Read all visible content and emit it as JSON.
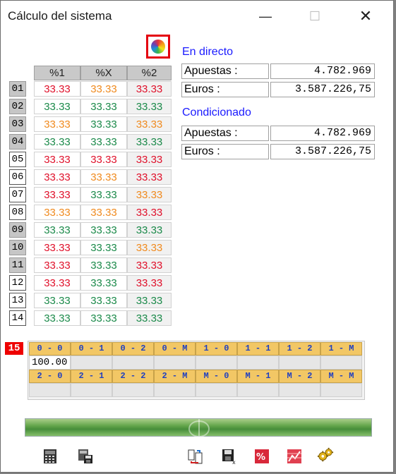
{
  "window": {
    "title": "Cálculo del sistema",
    "min": "—",
    "max": "☐",
    "close": "✕"
  },
  "columns": [
    "%1",
    "%X",
    "%2"
  ],
  "rows": [
    {
      "label": "01",
      "style": "g",
      "cells": [
        [
          "33.33",
          "red"
        ],
        [
          "33.33",
          "org"
        ],
        [
          "33.33",
          "red"
        ]
      ]
    },
    {
      "label": "02",
      "style": "g",
      "cells": [
        [
          "33.33",
          "grn"
        ],
        [
          "33.33",
          "grn"
        ],
        [
          "33.33",
          "grn"
        ]
      ]
    },
    {
      "label": "03",
      "style": "g",
      "cells": [
        [
          "33.33",
          "org"
        ],
        [
          "33.33",
          "grn"
        ],
        [
          "33.33",
          "org"
        ]
      ]
    },
    {
      "label": "04",
      "style": "g",
      "cells": [
        [
          "33.33",
          "grn"
        ],
        [
          "33.33",
          "grn"
        ],
        [
          "33.33",
          "grn"
        ]
      ]
    },
    {
      "label": "05",
      "style": "w",
      "cells": [
        [
          "33.33",
          "red"
        ],
        [
          "33.33",
          "red"
        ],
        [
          "33.33",
          "red"
        ]
      ]
    },
    {
      "label": "06",
      "style": "w",
      "cells": [
        [
          "33.33",
          "red"
        ],
        [
          "33.33",
          "org"
        ],
        [
          "33.33",
          "red"
        ]
      ]
    },
    {
      "label": "07",
      "style": "w",
      "cells": [
        [
          "33.33",
          "red"
        ],
        [
          "33.33",
          "grn"
        ],
        [
          "33.33",
          "org"
        ]
      ]
    },
    {
      "label": "08",
      "style": "w",
      "cells": [
        [
          "33.33",
          "org"
        ],
        [
          "33.33",
          "org"
        ],
        [
          "33.33",
          "red"
        ]
      ]
    },
    {
      "label": "09",
      "style": "g",
      "cells": [
        [
          "33.33",
          "grn"
        ],
        [
          "33.33",
          "grn"
        ],
        [
          "33.33",
          "grn"
        ]
      ]
    },
    {
      "label": "10",
      "style": "g",
      "cells": [
        [
          "33.33",
          "red"
        ],
        [
          "33.33",
          "grn"
        ],
        [
          "33.33",
          "org"
        ]
      ]
    },
    {
      "label": "11",
      "style": "g",
      "cells": [
        [
          "33.33",
          "red"
        ],
        [
          "33.33",
          "grn"
        ],
        [
          "33.33",
          "red"
        ]
      ]
    },
    {
      "label": "12",
      "style": "w",
      "cells": [
        [
          "33.33",
          "red"
        ],
        [
          "33.33",
          "grn"
        ],
        [
          "33.33",
          "red"
        ]
      ]
    },
    {
      "label": "13",
      "style": "w",
      "cells": [
        [
          "33.33",
          "grn"
        ],
        [
          "33.33",
          "grn"
        ],
        [
          "33.33",
          "grn"
        ]
      ]
    },
    {
      "label": "14",
      "style": "w",
      "cells": [
        [
          "33.33",
          "grn"
        ],
        [
          "33.33",
          "grn"
        ],
        [
          "33.33",
          "grn"
        ]
      ]
    }
  ],
  "en_directo": {
    "title": "En directo",
    "apuestas_label": "Apuestas :",
    "apuestas": "4.782.969",
    "euros_label": "Euros :",
    "euros": "3.587.226,75"
  },
  "condicionado": {
    "title": "Condicionado",
    "apuestas_label": "Apuestas :",
    "apuestas": "4.782.969",
    "euros_label": "Euros :",
    "euros": "3.587.226,75"
  },
  "pleno": {
    "badge": "15",
    "row1": [
      "0 - 0",
      "0 - 1",
      "0 - 2",
      "0 - M",
      "1 - 0",
      "1 - 1",
      "1 - 2",
      "1 - M"
    ],
    "row1_values": [
      "100.00",
      "",
      "",
      "",
      "",
      "",
      "",
      ""
    ],
    "row2": [
      "2 - 0",
      "2 - 1",
      "2 - 2",
      "2 - M",
      "M - 0",
      "M - 1",
      "M - 2",
      "M - M"
    ],
    "row2_values": [
      "",
      "",
      "",
      "",
      "",
      "",
      "",
      ""
    ]
  },
  "colors": {
    "red": "#e0102a",
    "green": "#1b8a4a",
    "orange": "#f08a1e",
    "link": "#1a1aff",
    "header_gold": "#f2c765"
  },
  "toolbar": [
    "calculator-icon",
    "save-grid-icon",
    "swap-icon",
    "save-as-icon",
    "percent-icon",
    "chart-icon",
    "gears-icon"
  ]
}
